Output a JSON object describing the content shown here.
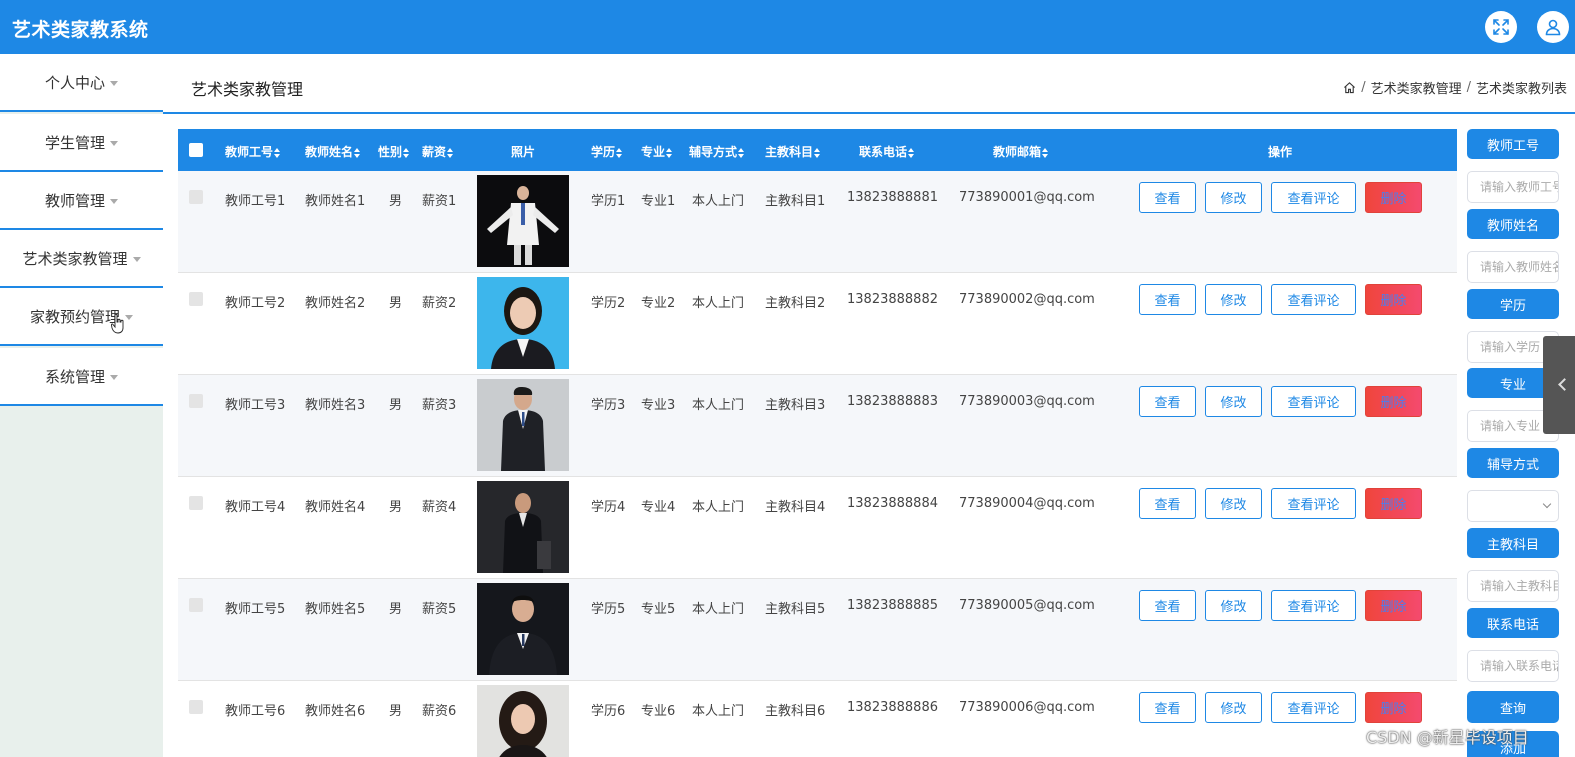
{
  "app": {
    "title": "艺术类家教系统"
  },
  "topbar": {
    "fullscreen_icon": "fullscreen-icon",
    "user_icon": "user-icon",
    "accent": "#1e88e5"
  },
  "sidebar": {
    "items": [
      {
        "label": "个人中心"
      },
      {
        "label": "学生管理"
      },
      {
        "label": "教师管理"
      },
      {
        "label": "艺术类家教管理"
      },
      {
        "label": "家教预约管理"
      },
      {
        "label": "系统管理"
      }
    ]
  },
  "header": {
    "page_title": "艺术类家教管理",
    "breadcrumb": [
      "艺术类家教管理",
      "艺术类家教列表"
    ]
  },
  "table": {
    "columns": [
      "教师工号",
      "教师姓名",
      "性别",
      "薪资",
      "照片",
      "学历",
      "专业",
      "辅导方式",
      "主教科目",
      "联系电话",
      "教师邮箱",
      "操作"
    ],
    "actions": {
      "view": "查看",
      "edit": "修改",
      "comment": "查看评论",
      "delete": "删除"
    },
    "rows": [
      {
        "id": "教师工号1",
        "name": "教师姓名1",
        "gender": "男",
        "salary": "薪资1",
        "edu": "学历1",
        "major": "专业1",
        "mode": "本人上门",
        "subject": "主教科目1",
        "phone": "13823888881",
        "email": "773890001@qq.com"
      },
      {
        "id": "教师工号2",
        "name": "教师姓名2",
        "gender": "男",
        "salary": "薪资2",
        "edu": "学历2",
        "major": "专业2",
        "mode": "本人上门",
        "subject": "主教科目2",
        "phone": "13823888882",
        "email": "773890002@qq.com"
      },
      {
        "id": "教师工号3",
        "name": "教师姓名3",
        "gender": "男",
        "salary": "薪资3",
        "edu": "学历3",
        "major": "专业3",
        "mode": "本人上门",
        "subject": "主教科目3",
        "phone": "13823888883",
        "email": "773890003@qq.com"
      },
      {
        "id": "教师工号4",
        "name": "教师姓名4",
        "gender": "男",
        "salary": "薪资4",
        "edu": "学历4",
        "major": "专业4",
        "mode": "本人上门",
        "subject": "主教科目4",
        "phone": "13823888884",
        "email": "773890004@qq.com"
      },
      {
        "id": "教师工号5",
        "name": "教师姓名5",
        "gender": "男",
        "salary": "薪资5",
        "edu": "学历5",
        "major": "专业5",
        "mode": "本人上门",
        "subject": "主教科目5",
        "phone": "13823888885",
        "email": "773890005@qq.com"
      },
      {
        "id": "教师工号6",
        "name": "教师姓名6",
        "gender": "男",
        "salary": "薪资6",
        "edu": "学历6",
        "major": "专业6",
        "mode": "本人上门",
        "subject": "主教科目6",
        "phone": "13823888886",
        "email": "773890006@qq.com"
      }
    ]
  },
  "search": {
    "fields": [
      {
        "label": "教师工号",
        "placeholder": "请输入教师工号"
      },
      {
        "label": "教师姓名",
        "placeholder": "请输入教师姓名"
      },
      {
        "label": "学历",
        "placeholder": "请输入学历"
      },
      {
        "label": "专业",
        "placeholder": "请输入专业"
      },
      {
        "label": "辅导方式",
        "placeholder": ""
      },
      {
        "label": "主教科目",
        "placeholder": "请输入主教科目"
      },
      {
        "label": "联系电话",
        "placeholder": "请输入联系电话"
      }
    ],
    "query_label": "查询",
    "add_label": "添加"
  },
  "watermark": "CSDN @新星毕设项目"
}
